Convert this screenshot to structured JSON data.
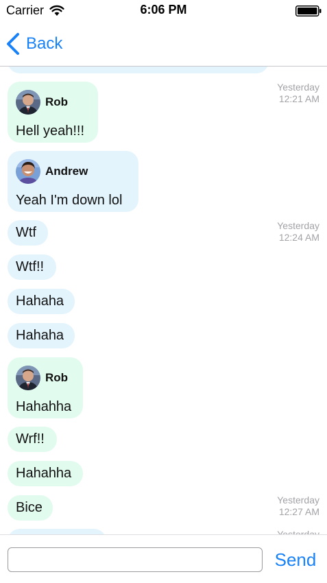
{
  "status_bar": {
    "carrier": "Carrier",
    "time": "6:06 PM",
    "wifi_icon": "wifi-icon",
    "battery_icon": "battery-icon"
  },
  "nav": {
    "back_label": "Back",
    "back_icon": "chevron-left-icon"
  },
  "colors": {
    "accent": "#1a82f7",
    "bubble_blue": "#e3f4fd",
    "bubble_green": "#e2fbef",
    "timestamp_gray": "#a2a2a7"
  },
  "messages": [
    {
      "text": ""
    },
    {
      "sender": "Rob",
      "text": "Hell yeah!!!",
      "timestamp_day": "Yesterday",
      "timestamp_time": "12:21 AM"
    },
    {
      "sender": "Andrew",
      "text": "Yeah I'm down lol"
    },
    {
      "text": "Wtf",
      "timestamp_day": "Yesterday",
      "timestamp_time": "12:24 AM"
    },
    {
      "text": "Wtf!!"
    },
    {
      "text": "Hahaha"
    },
    {
      "text": "Hahaha"
    },
    {
      "sender": "Rob",
      "text": "Hahahha"
    },
    {
      "text": "Wrf!!"
    },
    {
      "text": "Hahahha"
    },
    {
      "text": "Bice",
      "timestamp_day": "Yesterday",
      "timestamp_time": "12:27 AM"
    },
    {
      "text": "",
      "timestamp_day": "Yesterday"
    }
  ],
  "composer": {
    "input_value": "",
    "send_label": "Send"
  }
}
